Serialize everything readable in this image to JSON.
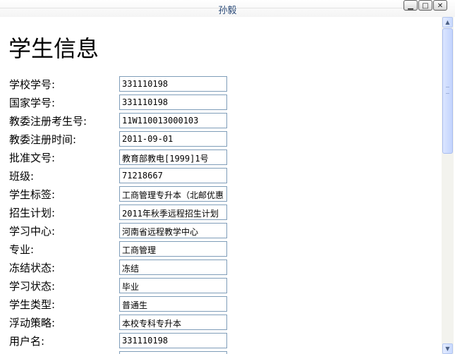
{
  "window": {
    "title": "孙毅"
  },
  "page": {
    "heading": "学生信息"
  },
  "fields": [
    {
      "label": "学校学号:",
      "value": "331110198"
    },
    {
      "label": "国家学号:",
      "value": "331110198"
    },
    {
      "label": "教委注册考生号:",
      "value": "11W110013000103"
    },
    {
      "label": "教委注册时间:",
      "value": "2011-09-01"
    },
    {
      "label": "批准文号:",
      "value": "教育部教电[1999]1号"
    },
    {
      "label": "班级:",
      "value": "71218667"
    },
    {
      "label": "学生标签:",
      "value": "工商管理专升本（北邮优惠"
    },
    {
      "label": "招生计划:",
      "value": "2011年秋季远程招生计划"
    },
    {
      "label": "学习中心:",
      "value": "河南省远程教学中心"
    },
    {
      "label": "专业:",
      "value": "工商管理"
    },
    {
      "label": "冻结状态:",
      "value": "冻结"
    },
    {
      "label": "学习状态:",
      "value": "毕业"
    },
    {
      "label": "学生类型:",
      "value": "普通生"
    },
    {
      "label": "浮动策略:",
      "value": "本校专科专升本"
    },
    {
      "label": "用户名:",
      "value": "331110198"
    },
    {
      "label": "",
      "value": ""
    }
  ],
  "icons": {
    "minimize": "minimize-icon",
    "maximize": "maximize-icon",
    "close": "close-icon",
    "scroll_up": "up-arrow-icon",
    "scroll_down": "down-arrow-icon"
  },
  "colors": {
    "title_text": "#2a4a78",
    "field_border": "#7f9db9",
    "scrollbar": "#c3d4fd"
  }
}
